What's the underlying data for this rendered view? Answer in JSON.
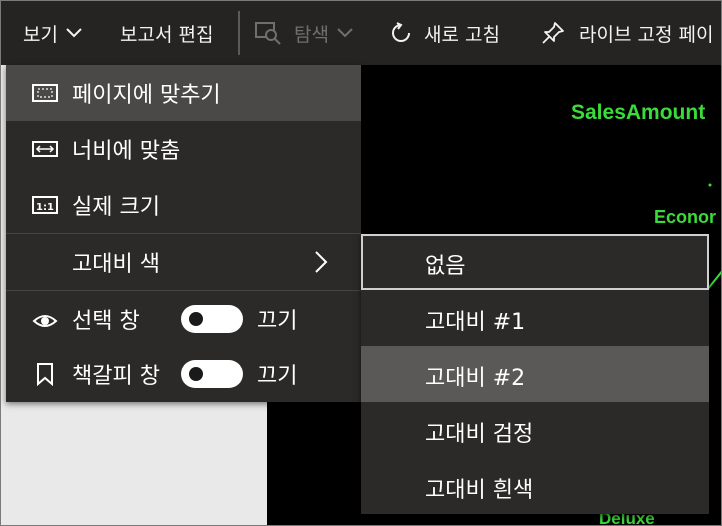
{
  "toolbar": {
    "view_label": "보기",
    "edit_report_label": "보고서 편집",
    "explore_label": "탐색",
    "refresh_label": "새로 고침",
    "pin_live_label": "라이브 고정 페이"
  },
  "canvas": {
    "label_sales": "SalesAmount",
    "label_econ": "Econor",
    "label_deluxe": "Deluxe"
  },
  "menu": {
    "fit_page": "페이지에 맞추기",
    "fit_width": "너비에 맞춤",
    "actual_size": "실제 크기",
    "high_contrast": "고대비 색",
    "selection_pane": "선택 창",
    "selection_state": "끄기",
    "bookmarks_pane": "책갈피 창",
    "bookmarks_state": "끄기"
  },
  "submenu": {
    "items": [
      "없음",
      "고대비 #1",
      "고대비 #2",
      "고대비 검정",
      "고대비 흰색"
    ]
  },
  "colors": {
    "canvas_text": "#3adb3a",
    "menu_bg": "#2b2a29",
    "toolbar_bg": "#252423"
  }
}
